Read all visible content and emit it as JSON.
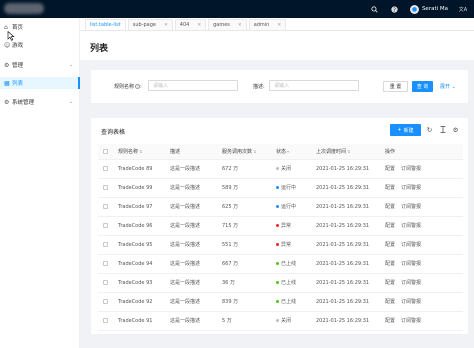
{
  "topbar": {
    "icons": [
      "search-icon",
      "question-icon"
    ],
    "user_name": "Serati Ma",
    "lang_glyph": "文A"
  },
  "sidebar": {
    "items": [
      {
        "label": "首页",
        "icon": "home-icon",
        "active": false,
        "expandable": false
      },
      {
        "label": "游戏",
        "icon": "game-icon",
        "active": false,
        "expandable": false
      },
      {
        "label": "管理",
        "icon": "setting-icon",
        "active": false,
        "expandable": true
      },
      {
        "label": "列表",
        "icon": "table-icon",
        "active": true,
        "expandable": false
      },
      {
        "label": "系统管理",
        "icon": "setting-icon",
        "active": false,
        "expandable": true
      }
    ]
  },
  "tabs": [
    {
      "label": "list.table-list",
      "active": true
    },
    {
      "label": "sub-page",
      "active": false
    },
    {
      "label": "404",
      "active": false
    },
    {
      "label": "games",
      "active": false
    },
    {
      "label": "admin",
      "active": false
    }
  ],
  "page": {
    "title": "列表"
  },
  "search": {
    "rule_label": "规则名称",
    "rule_placeholder": "请输入",
    "desc_label": "描述:",
    "desc_placeholder": "请输入",
    "reset_label": "重 置",
    "query_label": "查 询",
    "expand_label": "展开"
  },
  "table": {
    "title": "查询表格",
    "new_label": "新建",
    "columns": [
      "规则名称",
      "描述",
      "服务调用次数",
      "状态",
      "上次调度时间",
      "操作"
    ],
    "action_config": "配置",
    "action_subscribe": "订阅警报",
    "status_colors": {
      "关闭": "#bfbfbf",
      "运行中": "#1890ff",
      "异常": "#f5222d",
      "已上线": "#52c41a"
    },
    "rows": [
      {
        "name": "TradeCode 89",
        "desc": "这是一段描述",
        "calls": "672 万",
        "status": "关闭",
        "time": "2021-01-25 16:29:31"
      },
      {
        "name": "TradeCode 99",
        "desc": "这是一段描述",
        "calls": "589 万",
        "status": "运行中",
        "time": "2021-01-25 16:29:31"
      },
      {
        "name": "TradeCode 97",
        "desc": "这是一段描述",
        "calls": "625 万",
        "status": "运行中",
        "time": "2021-01-25 16:29:31"
      },
      {
        "name": "TradeCode 96",
        "desc": "这是一段描述",
        "calls": "715 万",
        "status": "异常",
        "time": "2021-01-25 16:29:31"
      },
      {
        "name": "TradeCode 95",
        "desc": "这是一段描述",
        "calls": "551 万",
        "status": "异常",
        "time": "2021-01-25 16:29:31"
      },
      {
        "name": "TradeCode 94",
        "desc": "这是一段描述",
        "calls": "667 万",
        "status": "已上线",
        "time": "2021-01-25 16:29:31"
      },
      {
        "name": "TradeCode 93",
        "desc": "这是一段描述",
        "calls": "36 万",
        "status": "已上线",
        "time": "2021-01-25 16:29:31"
      },
      {
        "name": "TradeCode 92",
        "desc": "这是一段描述",
        "calls": "839 万",
        "status": "已上线",
        "time": "2021-01-25 16:29:31"
      },
      {
        "name": "TradeCode 91",
        "desc": "这是一段描述",
        "calls": "5 万",
        "status": "关闭",
        "time": "2021-01-25 16:29:31"
      }
    ]
  }
}
